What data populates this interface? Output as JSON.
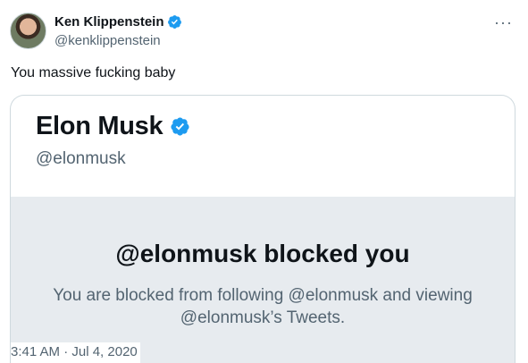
{
  "author": {
    "display_name": "Ken Klippenstein",
    "handle": "@kenklippenstein",
    "verified_icon": "verified-badge-icon",
    "avatar_icon": "avatar-photo"
  },
  "more_menu": {
    "label": "···",
    "icon": "more-options-icon"
  },
  "tweet": {
    "text": "You massive fucking baby",
    "timestamp": "3:41 AM · Jul 4, 2020"
  },
  "embedded_screenshot": {
    "display_name": "Elon Musk",
    "handle": "@elonmusk",
    "blocked_title": "@elonmusk blocked you",
    "blocked_message": "You are blocked from following @elonmusk and viewing @elonmusk’s Tweets."
  },
  "colors": {
    "verified_blue": "#1d9bf0",
    "text_primary": "#0f1419",
    "text_secondary": "#536471",
    "blocked_panel_bg": "#e7ebef",
    "border": "#cfd9de"
  }
}
